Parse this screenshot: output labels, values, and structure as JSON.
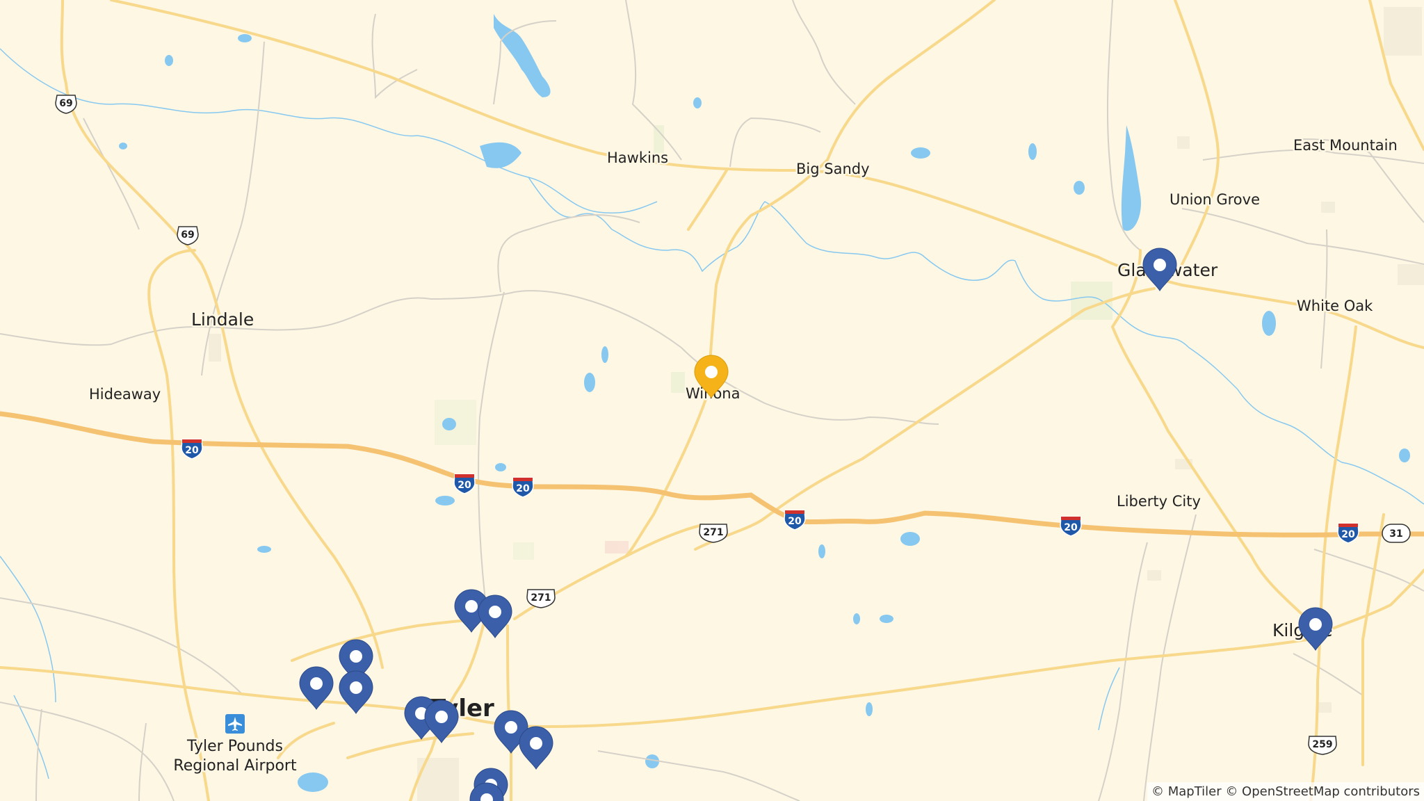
{
  "map": {
    "places": {
      "hawkins": "Hawkins",
      "big_sandy": "Big Sandy",
      "east_mountain": "East Mountain",
      "union_grove": "Union Grove",
      "gladewater": "Gladewater",
      "white_oak": "White Oak",
      "lindale": "Lindale",
      "hideaway": "Hideaway",
      "winona": "Winona",
      "liberty_city": "Liberty City",
      "kilgore": "Kilgore",
      "tyler": "Tyler",
      "airport_line1": "Tyler Pounds",
      "airport_line2": "Regional Airport"
    },
    "shields": {
      "us69": "69",
      "i20": "20",
      "us271": "271",
      "us259": "259",
      "tx31": "31"
    },
    "colors": {
      "land": "#fdf7e4",
      "water": "#86c8f0",
      "interstate": "#f5c271",
      "major_road": "#f8d88a",
      "minor_road": "#d5d1c8",
      "pin_blue": "#3b5fa8",
      "pin_selected": "#f6b319",
      "interstate_shield": "#1f58a8"
    }
  },
  "attribution": "© MapTiler © OpenStreetMap contributors"
}
